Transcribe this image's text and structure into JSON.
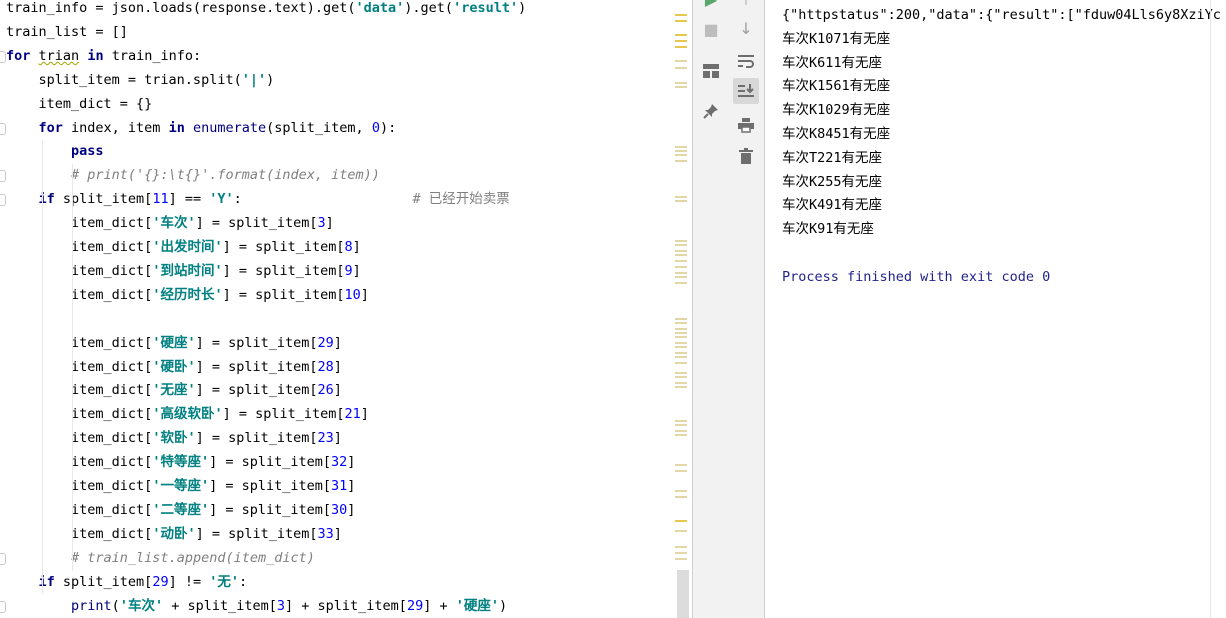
{
  "editor": {
    "lines": [
      {
        "segs": [
          [
            "t",
            "train_info = json.loads(response.text).get("
          ],
          [
            "s",
            "'data'"
          ],
          [
            "t",
            ").get("
          ],
          [
            "s",
            "'result'"
          ],
          [
            "t",
            ")"
          ]
        ]
      },
      {
        "segs": [
          [
            "t",
            "train_list = []"
          ]
        ]
      },
      {
        "segs": [
          [
            "k",
            "for"
          ],
          [
            "t",
            " "
          ],
          [
            "q",
            "trian"
          ],
          [
            "t",
            " "
          ],
          [
            "k",
            "in"
          ],
          [
            "t",
            " train_info:"
          ]
        ]
      },
      {
        "segs": [
          [
            "t",
            "    split_item = trian.split("
          ],
          [
            "s",
            "'|'"
          ],
          [
            "t",
            ")"
          ]
        ]
      },
      {
        "segs": [
          [
            "t",
            "    item_dict = {}"
          ]
        ]
      },
      {
        "segs": [
          [
            "t",
            "    "
          ],
          [
            "k",
            "for"
          ],
          [
            "t",
            " index, item "
          ],
          [
            "k",
            "in"
          ],
          [
            "t",
            " "
          ],
          [
            "f",
            "enumerate"
          ],
          [
            "t",
            "(split_item, "
          ],
          [
            "n",
            "0"
          ],
          [
            "t",
            "):"
          ]
        ]
      },
      {
        "segs": [
          [
            "t",
            "        "
          ],
          [
            "k",
            "pass"
          ]
        ]
      },
      {
        "segs": [
          [
            "t",
            "        "
          ],
          [
            "c",
            "# print('{}:\\t{}'.format(index, item))"
          ]
        ]
      },
      {
        "segs": [
          [
            "t",
            "    "
          ],
          [
            "k",
            "if"
          ],
          [
            "t",
            " split_item["
          ],
          [
            "n",
            "11"
          ],
          [
            "t",
            "] == "
          ],
          [
            "s",
            "'Y'"
          ],
          [
            "t",
            ":                     "
          ],
          [
            "cc",
            "# 已经开始卖票"
          ]
        ]
      },
      {
        "segs": [
          [
            "t",
            "        item_dict["
          ],
          [
            "s",
            "'车次'"
          ],
          [
            "t",
            "] = split_item["
          ],
          [
            "n",
            "3"
          ],
          [
            "t",
            "]"
          ]
        ]
      },
      {
        "segs": [
          [
            "t",
            "        item_dict["
          ],
          [
            "s",
            "'出发时间'"
          ],
          [
            "t",
            "] = split_item["
          ],
          [
            "n",
            "8"
          ],
          [
            "t",
            "]"
          ]
        ]
      },
      {
        "segs": [
          [
            "t",
            "        item_dict["
          ],
          [
            "s",
            "'到站时间'"
          ],
          [
            "t",
            "] = split_item["
          ],
          [
            "n",
            "9"
          ],
          [
            "t",
            "]"
          ]
        ]
      },
      {
        "segs": [
          [
            "t",
            "        item_dict["
          ],
          [
            "s",
            "'经历时长'"
          ],
          [
            "t",
            "] = split_item["
          ],
          [
            "n",
            "10"
          ],
          [
            "t",
            "]"
          ]
        ]
      },
      {
        "segs": []
      },
      {
        "segs": [
          [
            "t",
            "        item_dict["
          ],
          [
            "s",
            "'硬座'"
          ],
          [
            "t",
            "] = split_item["
          ],
          [
            "n",
            "29"
          ],
          [
            "t",
            "]"
          ]
        ]
      },
      {
        "segs": [
          [
            "t",
            "        item_dict["
          ],
          [
            "s",
            "'硬卧'"
          ],
          [
            "t",
            "] = split_item["
          ],
          [
            "n",
            "28"
          ],
          [
            "t",
            "]"
          ]
        ]
      },
      {
        "segs": [
          [
            "t",
            "        item_dict["
          ],
          [
            "s",
            "'无座'"
          ],
          [
            "t",
            "] = split_item["
          ],
          [
            "n",
            "26"
          ],
          [
            "t",
            "]"
          ]
        ]
      },
      {
        "segs": [
          [
            "t",
            "        item_dict["
          ],
          [
            "s",
            "'高级软卧'"
          ],
          [
            "t",
            "] = split_item["
          ],
          [
            "n",
            "21"
          ],
          [
            "t",
            "]"
          ]
        ]
      },
      {
        "segs": [
          [
            "t",
            "        item_dict["
          ],
          [
            "s",
            "'软卧'"
          ],
          [
            "t",
            "] = split_item["
          ],
          [
            "n",
            "23"
          ],
          [
            "t",
            "]"
          ]
        ]
      },
      {
        "segs": [
          [
            "t",
            "        item_dict["
          ],
          [
            "s",
            "'特等座'"
          ],
          [
            "t",
            "] = split_item["
          ],
          [
            "n",
            "32"
          ],
          [
            "t",
            "]"
          ]
        ]
      },
      {
        "segs": [
          [
            "t",
            "        item_dict["
          ],
          [
            "s",
            "'一等座'"
          ],
          [
            "t",
            "] = split_item["
          ],
          [
            "n",
            "31"
          ],
          [
            "t",
            "]"
          ]
        ]
      },
      {
        "segs": [
          [
            "t",
            "        item_dict["
          ],
          [
            "s",
            "'二等座'"
          ],
          [
            "t",
            "] = split_item["
          ],
          [
            "n",
            "30"
          ],
          [
            "t",
            "]"
          ]
        ]
      },
      {
        "segs": [
          [
            "t",
            "        item_dict["
          ],
          [
            "s",
            "'动卧'"
          ],
          [
            "t",
            "] = split_item["
          ],
          [
            "n",
            "33"
          ],
          [
            "t",
            "]"
          ]
        ]
      },
      {
        "segs": [
          [
            "t",
            "        "
          ],
          [
            "c",
            "# train_list.append(item_dict)"
          ]
        ]
      },
      {
        "segs": [
          [
            "t",
            "    "
          ],
          [
            "k",
            "if"
          ],
          [
            "t",
            " split_item["
          ],
          [
            "n",
            "29"
          ],
          [
            "t",
            "] != "
          ],
          [
            "s",
            "'无'"
          ],
          [
            "t",
            ":"
          ]
        ]
      },
      {
        "segs": [
          [
            "t",
            "        "
          ],
          [
            "f",
            "print"
          ],
          [
            "t",
            "("
          ],
          [
            "s",
            "'车次'"
          ],
          [
            "t",
            " + split_item["
          ],
          [
            "n",
            "3"
          ],
          [
            "t",
            "] + split_item["
          ],
          [
            "n",
            "29"
          ],
          [
            "t",
            "] + "
          ],
          [
            "s",
            "'硬座'"
          ],
          [
            "t",
            ")"
          ]
        ]
      }
    ]
  },
  "toolbar": {
    "left": [
      "run-icon",
      "stop-icon",
      "layout-icon",
      "pin-icon"
    ],
    "right": [
      "scroll-up-icon",
      "scroll-down-icon",
      "soft-wrap-icon",
      "scroll-to-end-icon",
      "print-icon",
      "trash-icon"
    ]
  },
  "console": {
    "lines": [
      "{\"httpstatus\":200,\"data\":{\"result\":[\"fduw04Lls6y8XziYc",
      "车次K1071有无座",
      "车次K611有无座",
      "车次K1561有无座",
      "车次K1029有无座",
      "车次K8451有无座",
      "车次T221有无座",
      "车次K255有无座",
      "车次K491有无座",
      "车次K91有无座",
      "",
      "Process finished with exit code 0"
    ]
  }
}
